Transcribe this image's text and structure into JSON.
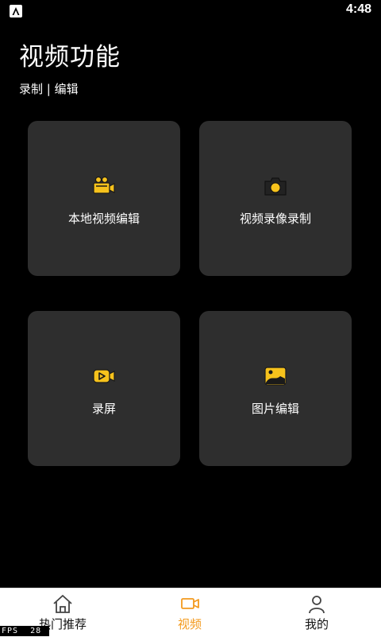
{
  "status_bar": {
    "time": "4:48",
    "app_icon": "app-a-icon"
  },
  "header": {
    "title": "视频功能",
    "subtitle": "录制 | 编辑"
  },
  "cards": [
    {
      "label": "本地视频编辑",
      "icon": "movie-camera-icon"
    },
    {
      "label": "视频录像录制",
      "icon": "camera-icon"
    },
    {
      "label": "录屏",
      "icon": "video-record-icon"
    },
    {
      "label": "图片编辑",
      "icon": "image-icon"
    }
  ],
  "tabbar": {
    "tabs": [
      {
        "label": "热门推荐",
        "icon": "home-icon",
        "active": false
      },
      {
        "label": "视频",
        "icon": "video-icon",
        "active": true
      },
      {
        "label": "我的",
        "icon": "user-icon",
        "active": false
      }
    ]
  },
  "fps": {
    "label": "FPS",
    "value": "28"
  },
  "colors": {
    "background": "#000000",
    "card": "#2e2e2e",
    "accent": "#f6c21c",
    "tab_active": "#f39a1e"
  }
}
